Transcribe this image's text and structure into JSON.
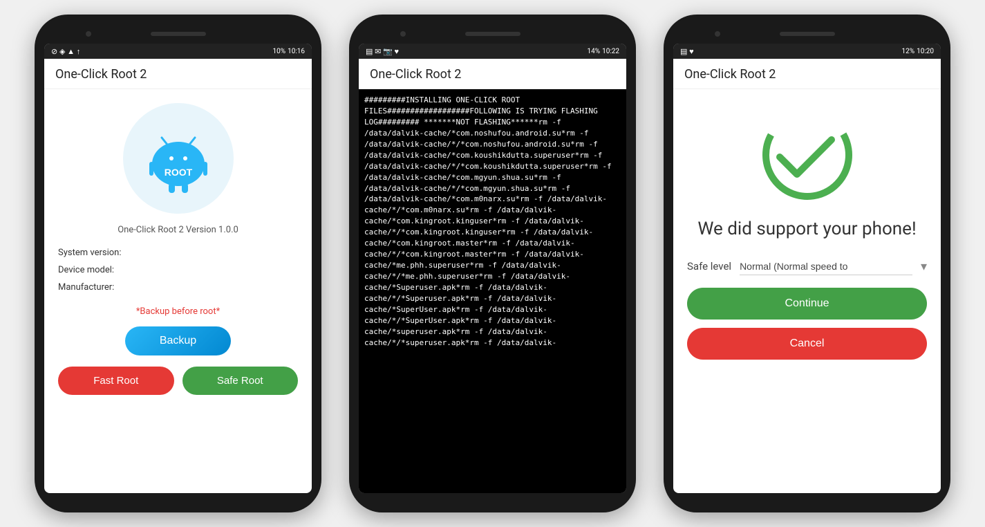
{
  "phone1": {
    "status": {
      "left_icons": "☉ ▾ ▾ ↑",
      "battery": "10%",
      "time": "10:16"
    },
    "title": "One-Click Root 2",
    "version": "One-Click Root 2 Version 1.0.0",
    "system_version_label": "System version:",
    "device_model_label": "Device model:",
    "manufacturer_label": "Manufacturer:",
    "backup_warning": "*Backup before root*",
    "backup_btn_label": "Backup",
    "fast_root_label": "Fast Root",
    "safe_root_label": "Safe Root"
  },
  "phone2": {
    "status": {
      "left_icons": "▤ ✉ 📷 ♥",
      "right_icons": "☉ ▾ ▾ ↑",
      "battery": "14%",
      "time": "10:22"
    },
    "title": "One-Click Root 2",
    "log_text": "#########INSTALLING ONE-CLICK ROOT FILES##################FOLLOWING IS TRYING FLASHING LOG######### *******NOT FLASHING******rm -f /data/dalvik-cache/*com.noshufou.android.su*rm -f /data/dalvik-cache/*/*com.noshufou.android.su*rm -f /data/dalvik-cache/*com.koushikdutta.superuser*rm -f /data/dalvik-cache/*/*com.koushikdutta.superuser*rm -f /data/dalvik-cache/*com.mgyun.shua.su*rm -f /data/dalvik-cache/*/*com.mgyun.shua.su*rm -f /data/dalvik-cache/*com.m0narx.su*rm -f /data/dalvik-cache/*/*com.m0narx.su*rm -f /data/dalvik-cache/*com.kingroot.kinguser*rm -f /data/dalvik-cache/*/*com.kingroot.kinguser*rm -f /data/dalvik-cache/*com.kingroot.master*rm -f /data/dalvik-cache/*/*com.kingroot.master*rm -f /data/dalvik-cache/*me.phh.superuser*rm -f /data/dalvik-cache/*/*me.phh.superuser*rm -f /data/dalvik-cache/*Superuser.apk*rm -f /data/dalvik-cache/*/*Superuser.apk*rm -f /data/dalvik-cache/*SuperUser.apk*rm -f /data/dalvik-cache/*/*SuperUser.apk*rm -f /data/dalvik-cache/*superuser.apk*rm -f /data/dalvik-cache/*/*superuser.apk*rm -f /data/dalvik-"
  },
  "phone3": {
    "status": {
      "left_icons": "▤ ♥",
      "right_icons": "☉ ▾ ▾ ↑",
      "battery": "12%",
      "time": "10:20"
    },
    "title": "One-Click Root 2",
    "support_text": "We did support your phone!",
    "safe_level_label": "Safe level",
    "safe_level_value": "Normal (Normal speed to",
    "continue_label": "Continue",
    "cancel_label": "Cancel"
  }
}
